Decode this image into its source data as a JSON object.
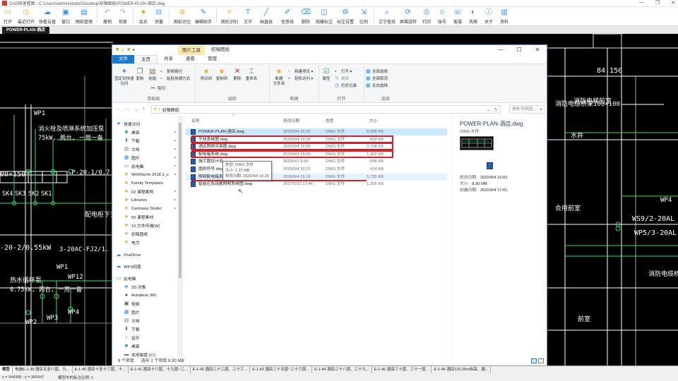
{
  "app": {
    "title": "CAD快速看图 - C:\\Users\\Administrator\\Desktop\\初稿图纸\\POWER-PLAN-酒店.dwg",
    "window_controls": [
      "—",
      "❐",
      "✕"
    ]
  },
  "toolbar": {
    "items": [
      {
        "label": "打开",
        "icon": "folder-open-icon",
        "glyph": "▭",
        "color": "#f2a31a"
      },
      {
        "label": "最近打开",
        "icon": "recent-icon",
        "glyph": "◷",
        "color": "#f2a31a"
      },
      {
        "label": "快看云盘",
        "icon": "cloud-icon",
        "glyph": "☁",
        "color": "#2c8cf4"
      },
      {
        "label": "窗口",
        "icon": "window-icon",
        "glyph": "▣",
        "color": "#2c8cf4"
      },
      {
        "label": "图纸管理",
        "icon": "drawing-manage-icon",
        "glyph": "▤",
        "color": "#2c8cf4"
      },
      {
        "label": "撤销",
        "icon": "undo-icon",
        "glyph": "↶",
        "color": "#aaaaaa"
      },
      {
        "label": "恢复",
        "icon": "redo-icon",
        "glyph": "↷",
        "color": "#aaaaaa"
      },
      {
        "label": "会员",
        "icon": "vip-icon",
        "glyph": "★",
        "color": "#f2a31a"
      },
      {
        "label": "测量",
        "icon": "measure-icon",
        "glyph": "⊟",
        "color": "#2c8cf4"
      },
      {
        "label": "图纸对比",
        "icon": "compare-icon",
        "glyph": "⧉",
        "color": "#f2a31a"
      },
      {
        "label": "编辑助手",
        "icon": "edit-assist-icon",
        "glyph": "✎",
        "color": "#2c8cf4"
      },
      {
        "label": "图形识别",
        "icon": "shape-recog-icon",
        "glyph": "⌗",
        "color": "#f2a31a"
      },
      {
        "label": "文字",
        "icon": "text-icon",
        "glyph": "T",
        "color": "#2c8cf4"
      },
      {
        "label": "画直线",
        "icon": "line-icon",
        "glyph": "╱",
        "color": "#2c8cf4"
      },
      {
        "label": "任意线",
        "icon": "freeline-icon",
        "glyph": "✐",
        "color": "#2c8cf4"
      },
      {
        "label": "删除",
        "icon": "erase-icon",
        "glyph": "⌫",
        "color": "#2c8cf4"
      },
      {
        "label": "隐藏标注",
        "icon": "hide-mark-icon",
        "glyph": "◫",
        "color": "#2c8cf4"
      },
      {
        "label": "标注设置",
        "icon": "mark-settings-icon",
        "glyph": "⚙",
        "color": "#2c8cf4"
      },
      {
        "label": "比例",
        "icon": "scale-icon",
        "glyph": "⇲",
        "color": "#2c8cf4"
      },
      {
        "label": "文字查找",
        "icon": "text-search-icon",
        "glyph": "⌕",
        "color": "#2c8cf4"
      },
      {
        "label": "屏幕旋转",
        "icon": "rotate-icon",
        "glyph": "⟳",
        "color": "#2c8cf4"
      },
      {
        "label": "打印",
        "icon": "print-icon",
        "glyph": "⎙",
        "color": "#2c8cf4"
      },
      {
        "label": "账号",
        "icon": "account-icon",
        "glyph": "☺",
        "color": "#2c8cf4"
      },
      {
        "label": "客服",
        "icon": "service-icon",
        "glyph": "☏",
        "color": "#2c8cf4"
      },
      {
        "label": "风格",
        "icon": "style-icon",
        "glyph": "◐",
        "color": "#2c8cf4"
      },
      {
        "label": "关于",
        "icon": "about-icon",
        "glyph": "ⓘ",
        "color": "#2c8cf4"
      },
      {
        "label": "资料",
        "icon": "docs-icon",
        "glyph": "▥",
        "color": "#2c8cf4"
      }
    ]
  },
  "doc_tab": {
    "label": "POWER-PLAN-酒店"
  },
  "cad": {
    "labels": [
      "WP1",
      "消火栓及喷淋系统加压泵",
      "75kW, 两台, 一用一备",
      "00×150",
      "-P-20-1/0.7",
      "SK4",
      "SK3",
      "SK2",
      "SK1",
      "配电柜下安装",
      "-20-2/0.55kW",
      "3-20AC-FJ2/1.",
      "WP1",
      "WP12",
      "热水循环泵",
      "0.75kW, 两台, 一用一备",
      "WP2",
      "WP3",
      "WP4",
      "消防电梯前室",
      "84.150",
      "消防电缆桥架100×100",
      "水井",
      "合用前室",
      "WP4",
      "WS9/2-20AL",
      "WP5/3-20AL",
      "消防电缆桥",
      "前室"
    ]
  },
  "explorer": {
    "tool_tab": "图片工具",
    "folder_title": "初稿图纸",
    "ribbon_tabs": [
      "文件",
      "主页",
      "共享",
      "查看",
      "管理"
    ],
    "groups": {
      "clipboard": {
        "label": "剪贴板",
        "pin": "固定到快速访问",
        "copy": "复制",
        "paste": "粘贴",
        "copy_path": "复制路径",
        "paste_shortcut": "粘贴快捷方式",
        "cut": "剪切"
      },
      "organize": {
        "label": "组织",
        "move_to": "移动到",
        "copy_to": "复制到",
        "delete": "删除",
        "rename": "重命名"
      },
      "new": {
        "label": "新建",
        "new_item": "新建项目 ▾",
        "easy_access": "轻松访问 ▾",
        "new_folder": "新建\n文件夹"
      },
      "open": {
        "label": "打开",
        "properties": "属性",
        "open": "打开 ▾",
        "edit": "编辑",
        "history": "历史记录"
      },
      "select": {
        "label": "选择",
        "select_all": "全部选择",
        "select_none": "全部取消",
        "invert": "反向选择"
      }
    },
    "address": {
      "path": [
        "初稿图纸"
      ],
      "search_placeholder": "搜索\"初稿图..."
    },
    "nav": [
      {
        "label": "快速访问",
        "icon": "star-icon",
        "glyph": "★",
        "color": "#2c8cf4",
        "pin": false,
        "level": 0
      },
      {
        "label": "桌面",
        "icon": "desktop-icon",
        "glyph": "■",
        "color": "#2c8cf4",
        "pin": true,
        "level": 1
      },
      {
        "label": "下载",
        "icon": "download-icon",
        "glyph": "⬇",
        "color": "#2c6cc4",
        "pin": true,
        "level": 1
      },
      {
        "label": "文档",
        "icon": "documents-icon",
        "glyph": "▤",
        "color": "#777777",
        "pin": true,
        "level": 1
      },
      {
        "label": "图片",
        "icon": "pictures-icon",
        "glyph": "▦",
        "color": "#2c8cf4",
        "pin": true,
        "level": 1
      },
      {
        "label": "此电脑",
        "icon": "computer-icon",
        "glyph": "▭",
        "color": "#2c8cf4",
        "pin": true,
        "level": 1
      },
      {
        "label": "WebStorm 2018.3_x",
        "icon": "folder-icon",
        "glyph": "■",
        "color": "#e8b84a",
        "pin": true,
        "level": 1
      },
      {
        "label": "Family Templates",
        "icon": "folder-icon",
        "glyph": "■",
        "color": "#e8b84a",
        "pin": false,
        "level": 1
      },
      {
        "label": "02 课程案例",
        "icon": "folder-icon",
        "glyph": "■",
        "color": "#e8b84a",
        "pin": true,
        "level": 1
      },
      {
        "label": "Libraries",
        "icon": "folder-icon",
        "glyph": "■",
        "color": "#e8b84a",
        "pin": true,
        "level": 1
      },
      {
        "label": "Camtasia Studio",
        "icon": "folder-icon",
        "glyph": "■",
        "color": "#e8b84a",
        "pin": true,
        "level": 1
      },
      {
        "label": "02 课程素材",
        "icon": "folder-icon",
        "glyph": "■",
        "color": "#e8b84a",
        "pin": false,
        "level": 1
      },
      {
        "label": "10 文件传输(W)",
        "icon": "folder-icon",
        "glyph": "■",
        "color": "#e8b84a",
        "pin": false,
        "level": 1
      },
      {
        "label": "初稿图纸",
        "icon": "folder-icon",
        "glyph": "■",
        "color": "#e8b84a",
        "pin": false,
        "level": 1
      },
      {
        "label": "电力",
        "icon": "folder-icon",
        "glyph": "■",
        "color": "#e8b84a",
        "pin": false,
        "level": 1
      },
      {
        "label": "OneDrive",
        "icon": "onedrive-icon",
        "glyph": "☁",
        "color": "#2c8cf4",
        "pin": false,
        "level": 0
      },
      {
        "label": "WPS网盘",
        "icon": "wps-cloud-icon",
        "glyph": "☁",
        "color": "#2c8cf4",
        "pin": false,
        "level": 0
      },
      {
        "label": "此电脑",
        "icon": "computer-icon",
        "glyph": "▭",
        "color": "#2c8cf4",
        "pin": false,
        "level": 0
      },
      {
        "label": "3D 对象",
        "icon": "3d-objects-icon",
        "glyph": "◈",
        "color": "#2c8cf4",
        "pin": false,
        "level": 1
      },
      {
        "label": "Autodesk 360",
        "icon": "autodesk-icon",
        "glyph": "●",
        "color": "#444444",
        "pin": false,
        "level": 1
      },
      {
        "label": "视频",
        "icon": "video-icon",
        "glyph": "▣",
        "color": "#555555",
        "pin": false,
        "level": 1
      },
      {
        "label": "图片",
        "icon": "pictures-icon",
        "glyph": "▦",
        "color": "#2c8cf4",
        "pin": false,
        "level": 1
      },
      {
        "label": "文档",
        "icon": "documents-icon",
        "glyph": "▤",
        "color": "#777777",
        "pin": false,
        "level": 1
      },
      {
        "label": "下载",
        "icon": "download-icon",
        "glyph": "⬇",
        "color": "#2c6cc4",
        "pin": false,
        "level": 1
      },
      {
        "label": "音乐",
        "icon": "music-icon",
        "glyph": "♪",
        "color": "#2c8cf4",
        "pin": false,
        "level": 1
      },
      {
        "label": "桌面",
        "icon": "desktop-icon",
        "glyph": "■",
        "color": "#2c8cf4",
        "pin": false,
        "level": 1
      },
      {
        "label": "本地磁盘 (C:)",
        "icon": "drive-icon",
        "glyph": "▬",
        "color": "#777777",
        "pin": false,
        "level": 1
      }
    ],
    "columns": {
      "name": "名称",
      "date": "修改日期",
      "type": "类型",
      "size": "大小"
    },
    "files": [
      {
        "name": "POWER-PLAN-酒店.dwg",
        "date": "2020/9/4 16:02",
        "type": "DWG 文件",
        "size": "8,508 KB",
        "state": "selected"
      },
      {
        "name": "干线系统图.dwg",
        "date": "2020/9/4 16:28",
        "type": "DWG 文件",
        "size": "659 KB",
        "state": "normal"
      },
      {
        "name": "酒店照明平面图.dwg",
        "date": "2020/9/4 16:09",
        "type": "DWG 文件",
        "size": "3,738 KB",
        "state": "normal"
      },
      {
        "name": "配电箱系统.dwg",
        "date": "2020/9/4 16:26",
        "type": "DWG 文件",
        "size": "1,302 KB",
        "state": "normal"
      },
      {
        "name": "施工图设计说",
        "date": "2020/9/1 9:35",
        "type": "DWG 文件",
        "size": "558 KB",
        "state": "normal"
      },
      {
        "name": "图例符号.dwg",
        "date": "2020/9/4 16:23",
        "type": "DWG 文件",
        "size": "414 KB",
        "state": "normal"
      },
      {
        "name": "照明配电箱系",
        "date": "2020/9/4 16:16",
        "type": "DWG 文件",
        "size": "5,735 KB",
        "state": "hover"
      },
      {
        "name": "智能应急疏散照明系统图.dwg",
        "date": "2017/2/22 17:44",
        "type": "DWG 文件",
        "size": "1,205 KB",
        "state": "normal"
      }
    ],
    "tooltip": [
      "类型: DWG 文件",
      "大小: 1.27 MB",
      "修改日期: 2020/9/4 16:26"
    ],
    "preview": {
      "title": "POWER-PLAN-酒店.dwg",
      "type": "DWG 文件",
      "modified_label": "修改日期:",
      "modified": "2020/9/4 16:02",
      "size_label": "大小:",
      "size": "8.30 MB",
      "created_label": "创建日期:",
      "created": "2020/9/4 17:01"
    },
    "status": {
      "count": "8 个项目",
      "selected": "选中 1 个项目  8.30 MB"
    }
  },
  "layout_tabs": [
    "模型",
    "电施E-1-39 酒店五至八层、九...",
    "E-1-40 酒店十至十三层、十...",
    "E-1-41 酒店十八层、十九层~二...",
    "E-1-42 酒店二十二层、二十三...",
    "E-1-43 酒店二十五层~二十六层...",
    "E-1-44 酒店二十八层、二十九...",
    "E-1-45 酒店三十层、三十一层...",
    "E-1-46 酒店133.25m标高、酒..."
  ],
  "status_bar": {
    "coord": "x = 944368 ; y = 389347",
    "msg": "模型中的标注比例: 1"
  }
}
